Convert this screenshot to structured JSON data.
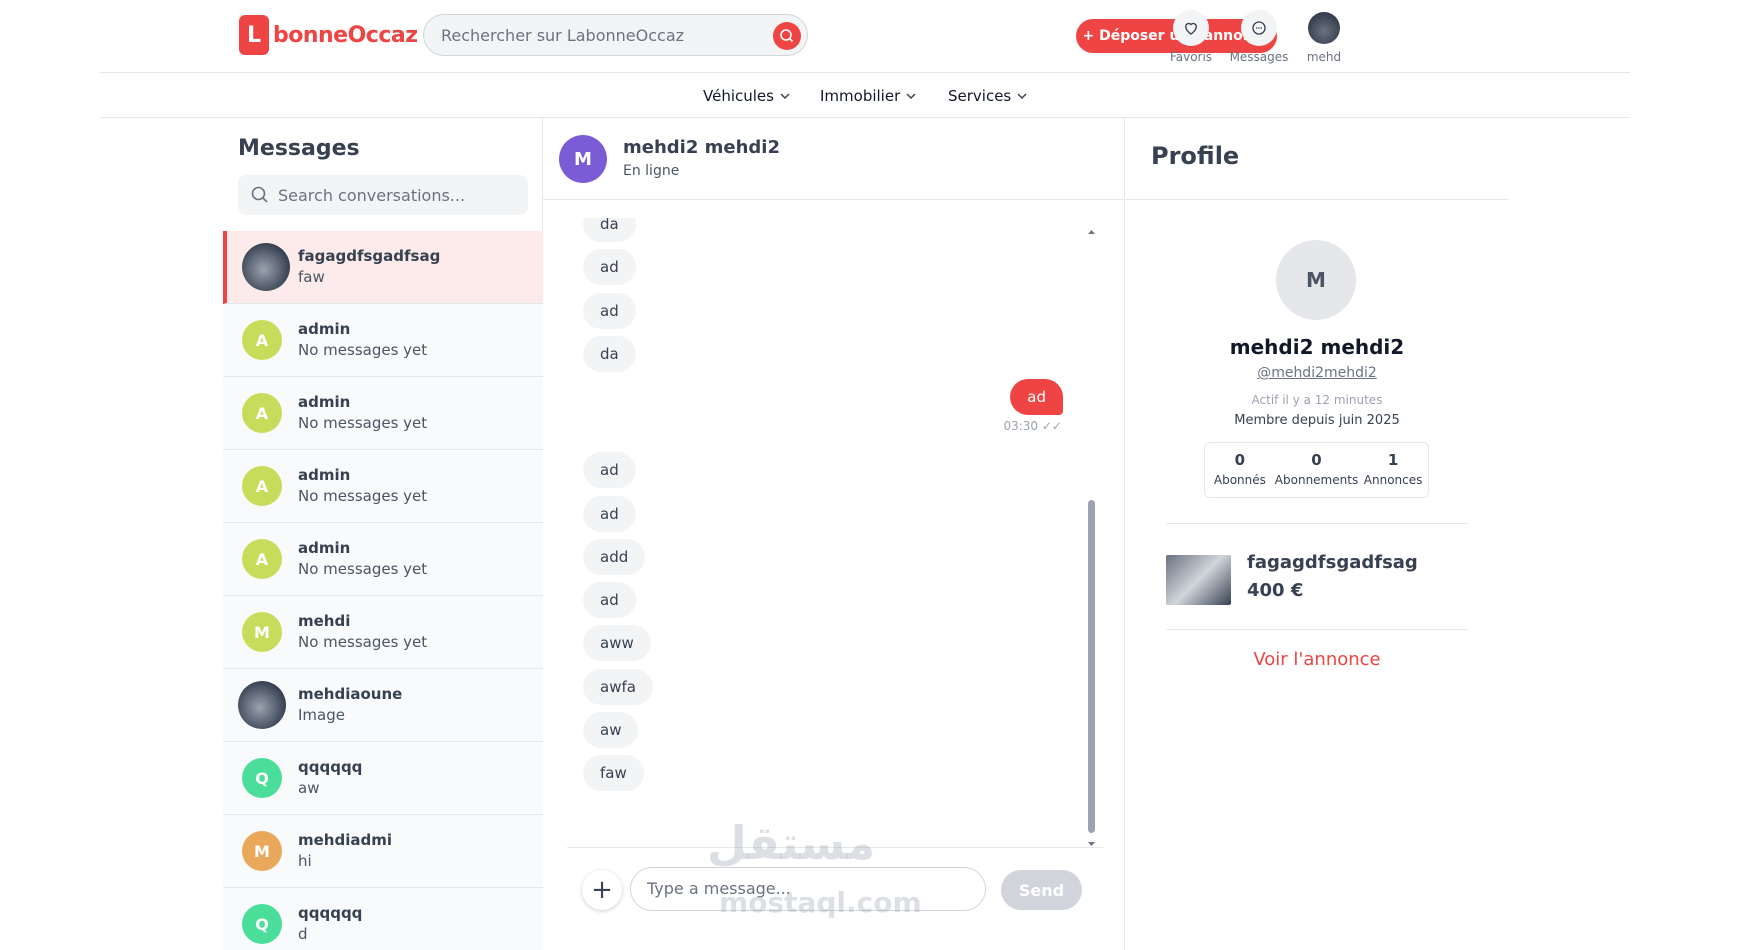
{
  "header": {
    "logo_letter": "L",
    "logo_text": "bonneOccaz",
    "search_placeholder": "Rechercher sur LabonneOccaz",
    "post_label": "+ Déposer une annonce",
    "favoris_label": "Favoris",
    "messages_label": "Messages",
    "user_label": "mehd"
  },
  "nav": [
    "Véhicules",
    "Immobilier",
    "Services"
  ],
  "sidebar": {
    "title": "Messages",
    "search_placeholder": "Search conversations...",
    "conversations": [
      {
        "name": "fagagdfsgadfsag",
        "last": "faw",
        "initial": "",
        "color": "",
        "active": true
      },
      {
        "name": "admin",
        "last": "No messages yet",
        "initial": "A",
        "color": "#c7dc5a"
      },
      {
        "name": "admin",
        "last": "No messages yet",
        "initial": "A",
        "color": "#c7dc5a"
      },
      {
        "name": "admin",
        "last": "No messages yet",
        "initial": "A",
        "color": "#c7dc5a"
      },
      {
        "name": "admin",
        "last": "No messages yet",
        "initial": "A",
        "color": "#c7dc5a"
      },
      {
        "name": "mehdi",
        "last": "No messages yet",
        "initial": "M",
        "color": "#c7dc5a"
      },
      {
        "name": "mehdiaoune",
        "last": "Image",
        "initial": "",
        "color": ""
      },
      {
        "name": "qqqqqq",
        "last": "aw",
        "initial": "Q",
        "color": "#4ade9a"
      },
      {
        "name": "mehdiadmi",
        "last": "hi",
        "initial": "M",
        "color": "#e9a85a"
      },
      {
        "name": "qqqqqq",
        "last": "d",
        "initial": "Q",
        "color": "#4ade9a"
      }
    ]
  },
  "chat": {
    "name": "mehdi2 mehdi2",
    "avatar_initial": "M",
    "status": "En ligne",
    "messages": [
      {
        "text": "da",
        "me": false
      },
      {
        "text": "ad",
        "me": false
      },
      {
        "text": "ad",
        "me": false
      },
      {
        "text": "da",
        "me": false
      },
      {
        "text": "ad",
        "me": true,
        "time": "03:30 ✓✓"
      },
      {
        "text": "ad",
        "me": false
      },
      {
        "text": "ad",
        "me": false
      },
      {
        "text": "add",
        "me": false
      },
      {
        "text": "ad",
        "me": false
      },
      {
        "text": "aww",
        "me": false
      },
      {
        "text": "awfa",
        "me": false
      },
      {
        "text": "aw",
        "me": false
      },
      {
        "text": "faw",
        "me": false
      }
    ],
    "input_placeholder": "Type a message...",
    "send_label": "Send",
    "watermark_ar": "مستقل",
    "watermark_en": "mostaql.com"
  },
  "profile": {
    "title": "Profile",
    "avatar_initial": "M",
    "name": "mehdi2 mehdi2",
    "username": "@mehdi2mehdi2",
    "active": "Actif il y a 12 minutes",
    "since": "Membre depuis juin 2025",
    "stats": [
      {
        "value": "0",
        "label": "Abonnés"
      },
      {
        "value": "0",
        "label": "Abonnements"
      },
      {
        "value": "1",
        "label": "Annonces"
      }
    ],
    "listing_title": "fagagdfsgadfsag",
    "listing_price": "400 €",
    "voir_label": "Voir l'annonce"
  }
}
